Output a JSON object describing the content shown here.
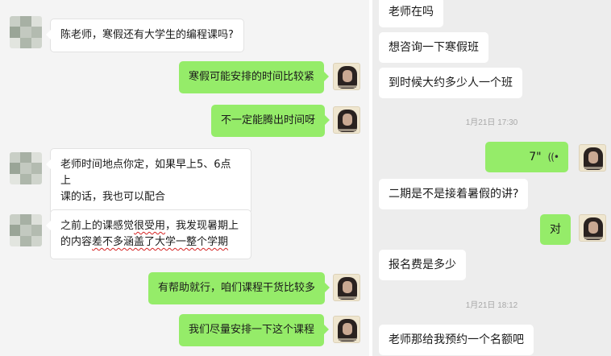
{
  "left_chat": {
    "messages": [
      {
        "side": "left",
        "text": "陈老师，寒假还有大学生的编程课吗?"
      },
      {
        "side": "right",
        "text": "寒假可能安排的时间比较紧"
      },
      {
        "side": "right",
        "text": "不一定能腾出时间呀"
      },
      {
        "side": "left",
        "lines": [
          "老师时间地点你定，如果早上5、6点上",
          "课的话，我也可以配合"
        ]
      },
      {
        "side": "left",
        "line1_a": "之前上的课感觉",
        "line1_b": "很受用",
        "line1_c": "，我发现暑期上",
        "line2_a": "的内容",
        "line2_b": "差不多涵盖了大学一整个学期"
      },
      {
        "side": "right",
        "text": "有帮助就行，咱们课程干货比较多"
      },
      {
        "side": "right",
        "text": "我们尽量安排一下这个课程"
      }
    ]
  },
  "right_chat": {
    "messages": [
      {
        "side": "left",
        "text": "老师在吗"
      },
      {
        "side": "left",
        "text": "想咨询一下寒假班"
      },
      {
        "side": "left",
        "text": "到时候大约多少人一个班"
      },
      {
        "type": "time",
        "text": "1月21日 17:30"
      },
      {
        "side": "right",
        "type": "voice",
        "duration": "7\"",
        "icon": "voice-wave-icon"
      },
      {
        "side": "left",
        "text": "二期是不是接着暑假的讲?"
      },
      {
        "side": "right",
        "text": "对"
      },
      {
        "side": "left",
        "text": "报名费是多少"
      },
      {
        "type": "time",
        "text": "1月21日 18:12"
      },
      {
        "side": "left",
        "text": "老师那给我预约一个名额吧"
      }
    ]
  },
  "colors": {
    "green_bubble": "#95ec69",
    "white_bubble": "#ffffff",
    "left_bg": "#f4f4f4",
    "right_bg": "#ededed",
    "underline_red": "#d42222"
  }
}
